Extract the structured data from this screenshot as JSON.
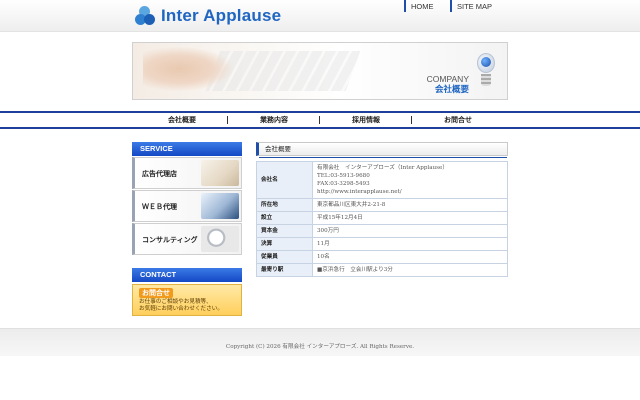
{
  "header": {
    "logo_text": "Inter Applause",
    "top_links": [
      "HOME",
      "SITE MAP"
    ]
  },
  "banner": {
    "title_en": "COMPANY",
    "title_jp": "会社概要"
  },
  "nav": {
    "items": [
      "会社概要",
      "業務内容",
      "採用情報",
      "お問合せ"
    ]
  },
  "sidebar": {
    "service_heading": "SERVICE",
    "service_items": [
      "広告代理店",
      "ＷＥＢ代理",
      "コンサルティング"
    ],
    "contact_heading": "CONTACT",
    "contact_title": "お問合せ",
    "contact_text_1": "お仕事のご相談やお見積等、",
    "contact_text_2": "お気軽にお問い合わせください。"
  },
  "content": {
    "heading": "会社概要",
    "company_name": {
      "label": "会社名",
      "line1": "有限会社　インターアプローズ（Inter Applause）",
      "line2": "TEL:03-5913-9680",
      "line3": "FAX:03-3298-5493",
      "line4": "http://www.interapplause.net/"
    },
    "rows": [
      {
        "label": "所在地",
        "value": "東京都品川区東大井2-21-8"
      },
      {
        "label": "設立",
        "value": "平成15年12月4日"
      },
      {
        "label": "資本金",
        "value": "300万円"
      },
      {
        "label": "決算",
        "value": "11月"
      },
      {
        "label": "従業員",
        "value": "10名"
      },
      {
        "label": "最寄り駅",
        "value": "■京浜急行　立会川駅より3分"
      }
    ]
  },
  "footer": {
    "copyright": "Copyright (C) 2026 有限会社 インターアプローズ. All Rights Reserve."
  },
  "colors": {
    "brand_blue": "#1f66c2",
    "nav_border": "#1f3f9a",
    "sidebar_heading": "#1448c4"
  }
}
